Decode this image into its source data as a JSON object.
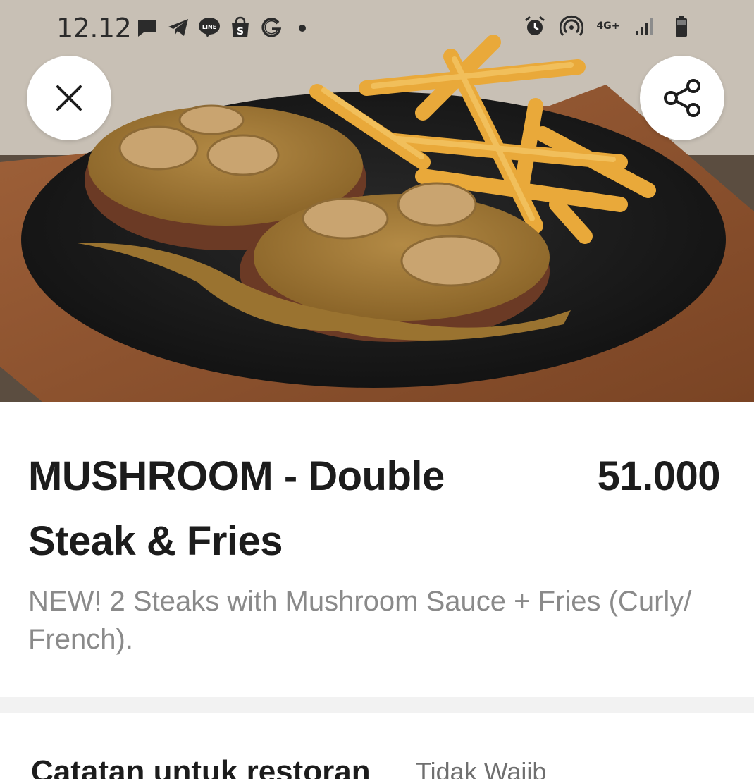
{
  "status_bar": {
    "time": "12.12",
    "network_label": "4G+",
    "left_icons": [
      "chat-bubble-icon",
      "telegram-icon",
      "line-icon",
      "shopee-icon",
      "g-icon",
      "dot-icon"
    ],
    "right_icons": [
      "alarm-icon",
      "hotspot-icon",
      "network-4g-icon",
      "signal-icon",
      "battery-icon"
    ]
  },
  "hero": {
    "close_icon": "close-icon",
    "share_icon": "share-icon"
  },
  "item": {
    "title": "MUSHROOM - Double Steak & Fries",
    "price": "51.000",
    "description": "NEW! 2 Steaks with Mushroom Sauce + Fries (Curly/ French)."
  },
  "notes": {
    "title": "Catatan untuk restoran",
    "optional_label": "Tidak Wajib"
  },
  "colors": {
    "text_primary": "#1c1c1c",
    "text_secondary": "#8a8a8a",
    "divider": "#f2f2f2"
  }
}
